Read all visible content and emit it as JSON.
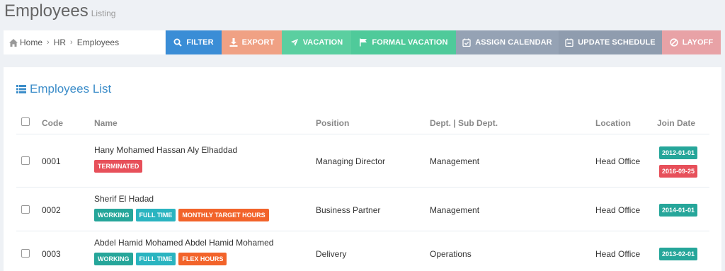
{
  "page": {
    "title": "Employees",
    "subtitle": "Listing"
  },
  "breadcrumb": {
    "home": "Home",
    "hr": "HR",
    "current": "Employees"
  },
  "actions": {
    "filter": "FILTER",
    "export": "EXPORT",
    "vacation": "VACATION",
    "formal_vacation": "FORMAL VACATION",
    "assign_calendar": "ASSIGN CALENDAR",
    "update_schedule": "UPDATE SCHEDULE",
    "layoff": "LAYOFF"
  },
  "panel": {
    "title": "Employees List"
  },
  "table": {
    "headers": {
      "code": "Code",
      "name": "Name",
      "position": "Position",
      "dept": "Dept. | Sub Dept.",
      "location": "Location",
      "join_date": "Join Date"
    },
    "rows": [
      {
        "code": "0001",
        "name": "Hany Mohamed Hassan Aly Elhaddad",
        "tags": [
          "TERMINATED"
        ],
        "position": "Managing Director",
        "dept": "Management",
        "location": "Head Office",
        "dates": [
          "2012-01-01",
          "2016-09-25"
        ]
      },
      {
        "code": "0002",
        "name": "Sherif El Hadad",
        "tags": [
          "WORKING",
          "FULL TIME",
          "MONTHLY TARGET HOURS"
        ],
        "position": "Business Partner",
        "dept": "Management",
        "location": "Head Office",
        "dates": [
          "2014-01-01"
        ]
      },
      {
        "code": "0003",
        "name": "Abdel Hamid Mohamed Abdel Hamid Mohamed",
        "tags": [
          "WORKING",
          "FULL TIME",
          "FLEX HOURS"
        ],
        "position": "Delivery",
        "dept": "Operations",
        "location": "Head Office",
        "dates": [
          "2013-02-01"
        ]
      }
    ]
  },
  "colors": {
    "accent": "#3c8dc9",
    "terminated": "#e7505a",
    "working": "#26a69a",
    "fulltime": "#2ab4c0",
    "hours": "#f2632a"
  }
}
